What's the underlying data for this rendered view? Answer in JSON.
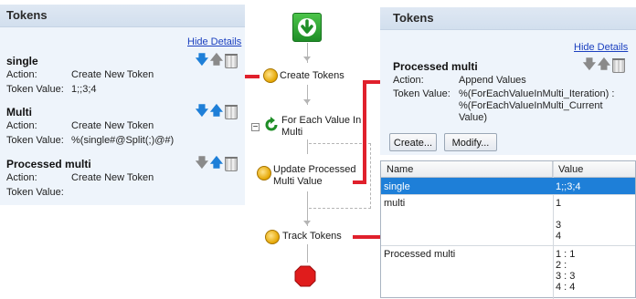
{
  "left_panel": {
    "title": "Tokens",
    "hide_details": "Hide Details",
    "action_label": "Action:",
    "token_value_label": "Token Value:",
    "tokens": [
      {
        "name": "single",
        "action": "Create New Token",
        "value": "1;;3;4"
      },
      {
        "name": "Multi",
        "action": "Create New Token",
        "value": "%(single#@Split(;)@#)"
      },
      {
        "name": "Processed multi",
        "action": "Create New Token",
        "value": ""
      }
    ]
  },
  "flow": {
    "steps": [
      {
        "label": "Create Tokens"
      },
      {
        "label": "For Each Value In Multi"
      },
      {
        "label": "Update Processed Multi Value"
      },
      {
        "label": "Track Tokens"
      }
    ],
    "collapse_symbol": "−"
  },
  "right_panel": {
    "title": "Tokens",
    "hide_details": "Hide Details",
    "token_name": "Processed multi",
    "action_label": "Action:",
    "action_value": "Append Values",
    "token_value_label": "Token Value:",
    "token_value_lines": [
      "%(ForEachValueInMulti_Iteration) :",
      "%(ForEachValueInMulti_Current",
      "Value)"
    ],
    "create_button": "Create...",
    "modify_button": "Modify..."
  },
  "grid": {
    "columns": [
      "Name",
      "Value"
    ],
    "rows": [
      {
        "name": "single",
        "value": "1;;3;4",
        "selected": true
      },
      {
        "name": "multi",
        "value": "1\n\n3\n4",
        "selected": false
      },
      {
        "name": "Processed multi",
        "value": "1 : 1\n2 :\n3 : 3\n4 : 4",
        "selected": false
      }
    ]
  },
  "colors": {
    "accent_red": "#e0202c",
    "selection_blue": "#1e7fd8",
    "panel_bg": "#eef4fb"
  }
}
